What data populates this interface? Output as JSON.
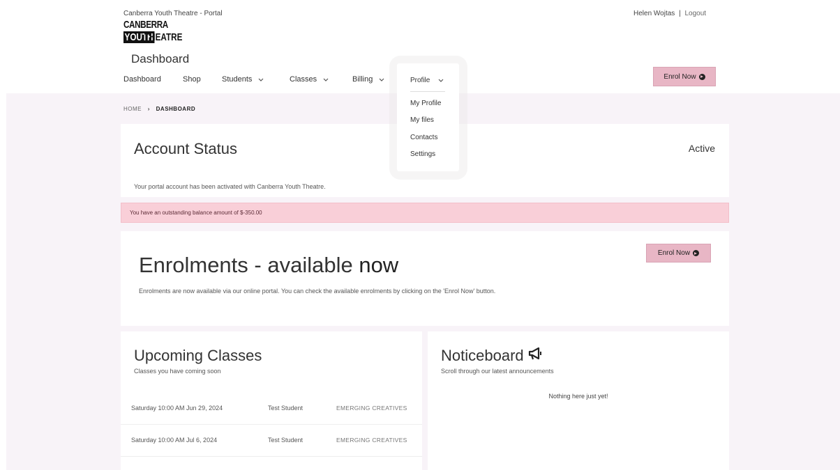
{
  "header": {
    "site_title": "Canberra Youth Theatre - Portal",
    "user_name": "Helen Wojtas",
    "separator": "|",
    "logout_label": "Logout",
    "logo": {
      "line1": "CANBERRA",
      "line2a": "YOUTH",
      "line2b": "THEATRE"
    },
    "page_title": "Dashboard",
    "enrol_label": "Enrol Now"
  },
  "nav": {
    "items": [
      {
        "label": "Dashboard"
      },
      {
        "label": "Shop"
      },
      {
        "label": "Students"
      },
      {
        "label": "Classes"
      },
      {
        "label": "Billing"
      },
      {
        "label": "Profile"
      }
    ]
  },
  "profile_menu": {
    "head": "Profile",
    "items": [
      "My Profile",
      "My files",
      "Contacts",
      "Settings"
    ]
  },
  "breadcrumb": {
    "home": "HOME",
    "current": "DASHBOARD"
  },
  "account_status": {
    "title": "Account Status",
    "value": "Active",
    "message": "Your portal account has been activated with Canberra Youth Theatre."
  },
  "alert": {
    "text": "You have an outstanding balance amount of $-350.00"
  },
  "enrolments": {
    "title_main": "Enrolments - available",
    "title_bold": "now",
    "description": "Enrolments are now available via our online portal. You can check the available enrolments by clicking on the 'Enrol Now' button.",
    "button_label": "Enrol Now"
  },
  "upcoming_classes": {
    "title": "Upcoming Classes",
    "subtitle": "Classes you have coming soon",
    "rows": [
      {
        "date": "Saturday 10:00 AM Jun 29, 2024",
        "student": "Test Student",
        "class": "EMERGING CREATIVES"
      },
      {
        "date": "Saturday 10:00 AM Jul 6, 2024",
        "student": "Test Student",
        "class": "EMERGING CREATIVES"
      }
    ]
  },
  "noticeboard": {
    "title": "Noticeboard",
    "icon": "megaphone-icon",
    "subtitle": "Scroll through our latest announcements",
    "empty_text": "Nothing here just yet!"
  }
}
